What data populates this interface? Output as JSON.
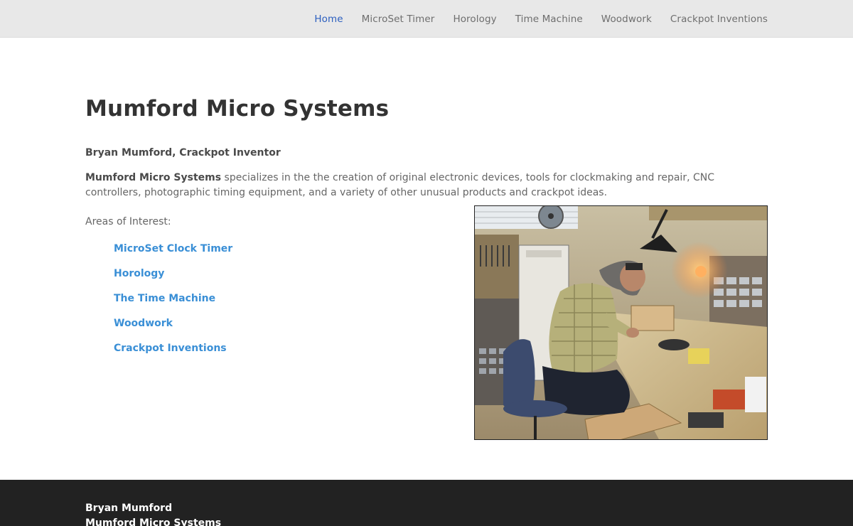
{
  "nav": {
    "items": [
      {
        "label": "Home",
        "active": true
      },
      {
        "label": "MicroSet Timer",
        "active": false
      },
      {
        "label": "Horology",
        "active": false
      },
      {
        "label": "Time Machine",
        "active": false
      },
      {
        "label": "Woodwork",
        "active": false
      },
      {
        "label": "Crackpot Inventions",
        "active": false
      }
    ]
  },
  "main": {
    "title": "Mumford Micro Systems",
    "byline": "Bryan Mumford, Crackpot Inventor",
    "intro_bold": "Mumford Micro Systems",
    "intro_rest": " specializes in the the creation of original electronic devices, tools for clockmaking and repair, CNC controllers, photographic timing equipment, and a variety of other unusual products and crackpot ideas.",
    "areas_label": "Areas of Interest:",
    "areas": [
      "MicroSet Clock Timer",
      "Horology",
      "The Time Machine",
      "Woodwork",
      "Crackpot Inventions"
    ]
  },
  "footer": {
    "line1": "Bryan Mumford",
    "line2": "Mumford Micro Systems"
  },
  "colors": {
    "nav_active": "#2c5fbf",
    "link": "#3a8fd6",
    "footer_bg": "#222222"
  }
}
